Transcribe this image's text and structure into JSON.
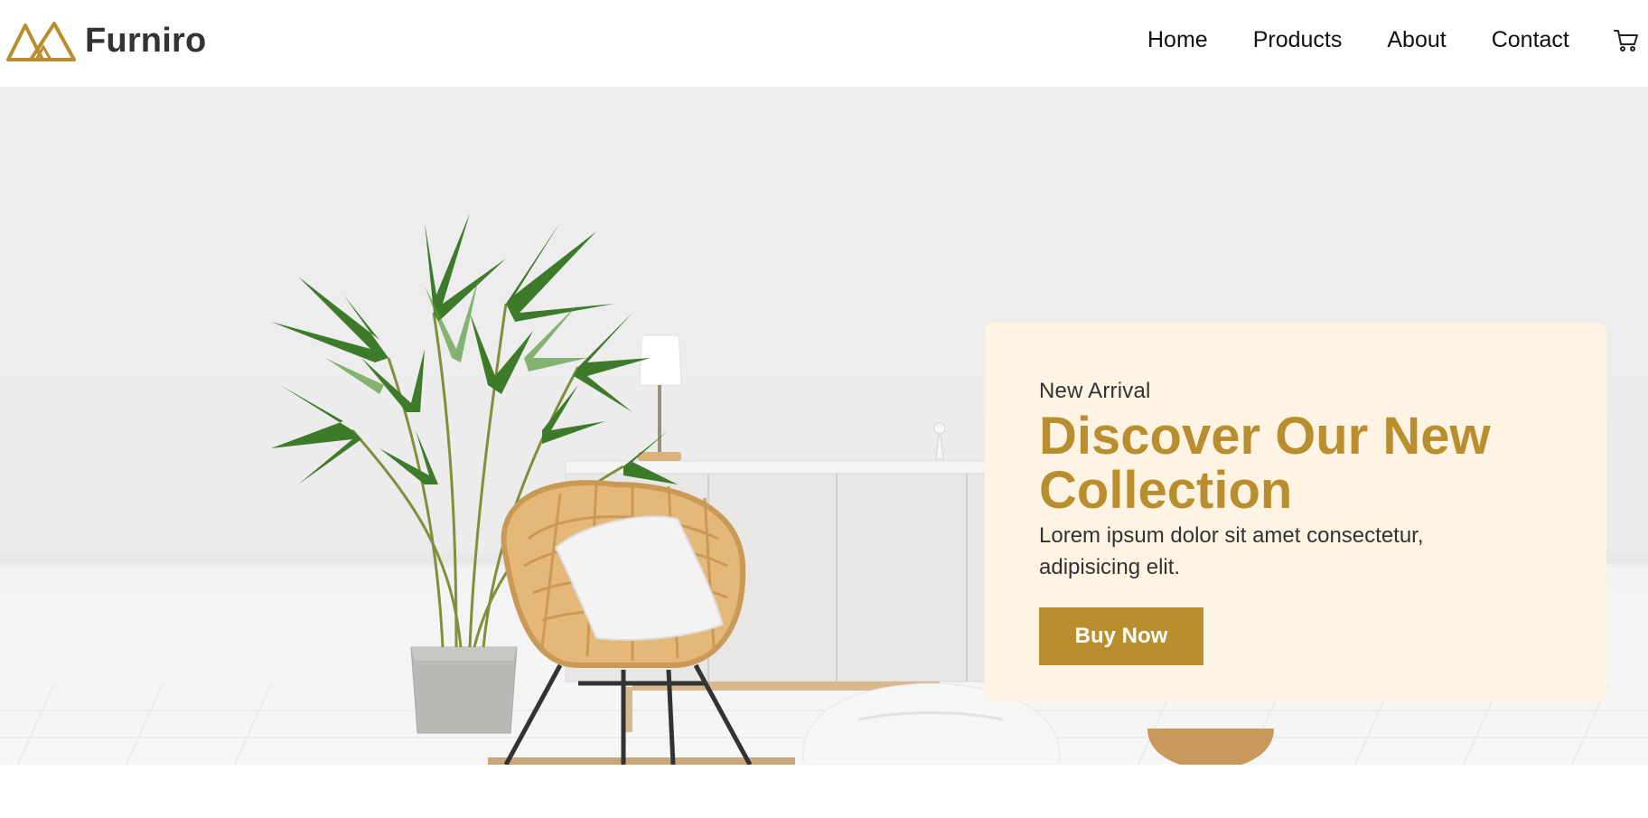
{
  "brand": {
    "name": "Furniro",
    "logo_icon": "furniro-logo-icon",
    "accent": "#b88e2f"
  },
  "nav": {
    "items": [
      {
        "label": "Home"
      },
      {
        "label": "Products"
      },
      {
        "label": "About"
      },
      {
        "label": "Contact"
      }
    ],
    "cart_icon": "cart-icon"
  },
  "hero": {
    "image": "living-room-with-plant-rattan-chair-and-sideboard",
    "card_background": "#fff3e3",
    "kicker": "New Arrival",
    "title": "Discover Our New Collection",
    "description": "Lorem ipsum dolor sit amet consectetur, adipisicing elit.",
    "cta_label": "Buy Now"
  }
}
